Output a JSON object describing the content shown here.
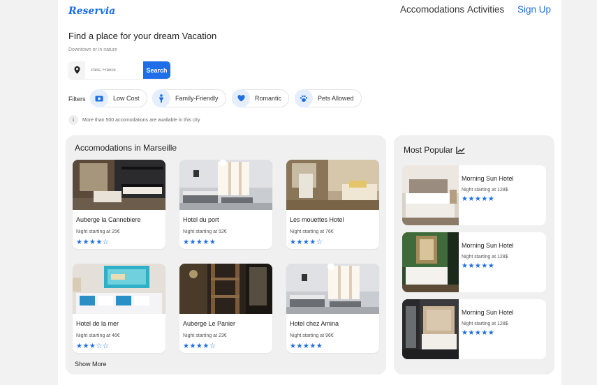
{
  "header": {
    "logo": "Reservia",
    "nav": [
      "Accomodations",
      "Activities"
    ],
    "signup": "Sign Up"
  },
  "hero": {
    "title": "Find a place for your dream Vacation",
    "subtitle": "Downtown or in nature"
  },
  "search": {
    "placeholder": "Paris, France",
    "button": "Search"
  },
  "filters": {
    "label": "Filters",
    "items": [
      {
        "label": "Low Cost",
        "icon": "money-icon"
      },
      {
        "label": "Family-Friendly",
        "icon": "person-icon"
      },
      {
        "label": "Romantic",
        "icon": "heart-icon"
      },
      {
        "label": "Pets Allowed",
        "icon": "paw-icon"
      }
    ]
  },
  "info": {
    "icon": "i",
    "text": "More than 500 accomodations are available in this city"
  },
  "accommodations": {
    "title": "Accomodations in Marseille",
    "show_more": "Show More",
    "cards": [
      {
        "name": "Auberge la Cannebiere",
        "price": "Night starting at 25€",
        "stars": "★★★★☆",
        "rating": 4,
        "photo": "dorm-bunk-bed"
      },
      {
        "name": "Hotel du port",
        "price": "Night starting at 52€",
        "stars": "★★★★★",
        "rating": 5,
        "photo": "bright-twin-room"
      },
      {
        "name": "Les mouettes Hotel",
        "price": "Night starting at 76€",
        "stars": "★★★★☆",
        "rating": 4,
        "photo": "warm-room"
      },
      {
        "name": "Hotel de la mer",
        "price": "Night starting at 46€",
        "stars": "★★★☆☆",
        "rating": 3,
        "photo": "sea-painting-room"
      },
      {
        "name": "Auberge Le Panier",
        "price": "Night starting at 23€",
        "stars": "★★★★☆",
        "rating": 4,
        "photo": "dark-bunk-room"
      },
      {
        "name": "Hotel chez Amina",
        "price": "Night starting at 96€",
        "stars": "★★★★★",
        "rating": 5,
        "photo": "bright-twin-room"
      }
    ]
  },
  "popular": {
    "title": "Most Popular",
    "icon": "trend-chart-icon",
    "cards": [
      {
        "name": "Morning Sun Hotel",
        "price": "Night starting at 128$",
        "stars": "★★★★★",
        "rating": 5,
        "photo": "white-bed-room"
      },
      {
        "name": "Morning Sun Hotel",
        "price": "Night starting at 128$",
        "stars": "★★★★★",
        "rating": 5,
        "photo": "green-wall-room"
      },
      {
        "name": "Morning Sun Hotel",
        "price": "Night starting at 128$",
        "stars": "★★★★★",
        "rating": 5,
        "photo": "chic-bed-room"
      }
    ]
  },
  "colors": {
    "accent": "#1e6ee8",
    "panel": "#f0f0f0",
    "chip_icon_bg": "#e5eefc"
  }
}
